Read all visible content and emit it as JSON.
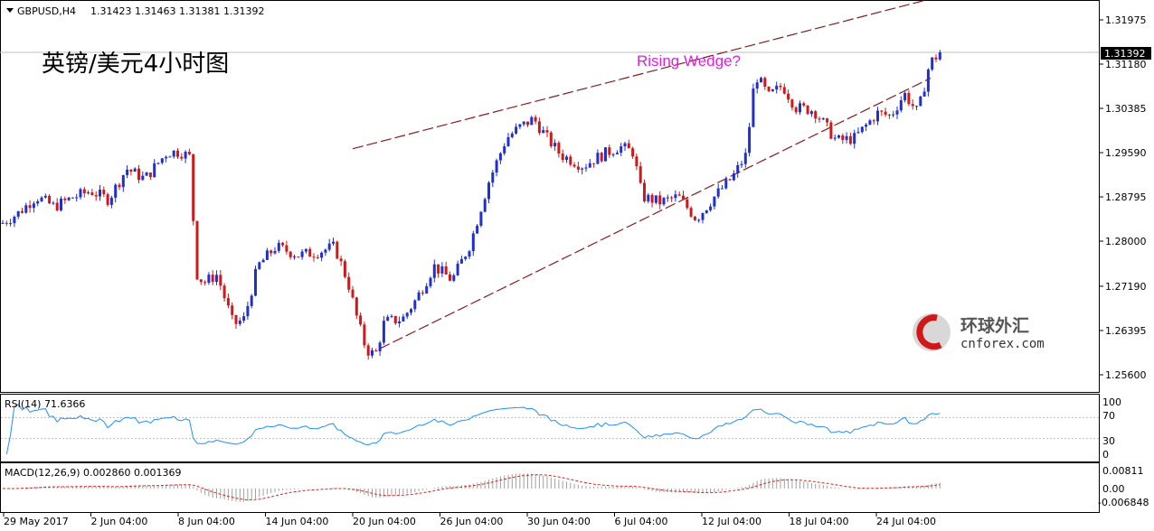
{
  "header": {
    "symbol": "GBPUSD,H4",
    "ohlc": "1.31423 1.31463 1.31381 1.31392",
    "chart_title": "英镑/美元4小时图",
    "annotation": "Rising Wedge?",
    "current_price_label": "1.31392"
  },
  "watermark": {
    "line1": "环球外汇",
    "line2": "cnforex.com"
  },
  "rsi": {
    "label": "RSI(14) 71.6366",
    "ticks": [
      "100",
      "70",
      "30",
      "0"
    ],
    "value": 71.6366
  },
  "macd": {
    "label": "MACD(12,26,9) 0.002860 0.001369",
    "ticks": [
      "0.00811",
      "0.00",
      "-0.006848"
    ]
  },
  "colors": {
    "bull": "#1f2fd0",
    "bear": "#d01818",
    "wedge": "#8b1a1a",
    "rsi_line": "#1e90ff",
    "macd_signal": "#e02020",
    "annotation": "#e020e0"
  },
  "chart_data": {
    "type": "candlestick",
    "title": "英镑/美元4小时图",
    "symbol": "GBPUSD,H4",
    "timeframe": "H4",
    "y_ticks": [
      "1.31975",
      "1.31180",
      "1.30385",
      "1.29590",
      "1.28795",
      "1.28000",
      "1.27190",
      "1.26395",
      "1.25600"
    ],
    "ylim": [
      1.2535,
      1.3222
    ],
    "x_ticks": [
      "29 May 2017",
      "2 Jun 04:00",
      "8 Jun 04:00",
      "14 Jun 04:00",
      "20 Jun 04:00",
      "26 Jun 04:00",
      "30 Jun 04:00",
      "6 Jul 04:00",
      "12 Jul 04:00",
      "18 Jul 04:00",
      "24 Jul 04:00"
    ],
    "last_close": 1.31392,
    "wedge_upper": {
      "from": [
        "20 Jun 04:00",
        1.2966
      ],
      "to": [
        "24 Jul 04:00",
        1.321
      ]
    },
    "wedge_lower": {
      "from": [
        "20 Jun 04:00",
        1.2583
      ],
      "to": [
        "24 Jul 04:00",
        1.3045
      ]
    },
    "price_path": [
      [
        0,
        1.283
      ],
      [
        20,
        1.285
      ],
      [
        40,
        1.288
      ],
      [
        60,
        1.2862
      ],
      [
        80,
        1.2878
      ],
      [
        100,
        1.289
      ],
      [
        120,
        1.2875
      ],
      [
        140,
        1.293
      ],
      [
        160,
        1.2912
      ],
      [
        185,
        1.296
      ],
      [
        200,
        1.296
      ],
      [
        211,
        1.295
      ],
      [
        216,
        1.2745
      ],
      [
        225,
        1.2725
      ],
      [
        240,
        1.274
      ],
      [
        258,
        1.265
      ],
      [
        270,
        1.266
      ],
      [
        285,
        1.2755
      ],
      [
        305,
        1.279
      ],
      [
        330,
        1.2775
      ],
      [
        350,
        1.278
      ],
      [
        370,
        1.279
      ],
      [
        385,
        1.2725
      ],
      [
        395,
        1.266
      ],
      [
        405,
        1.2605
      ],
      [
        415,
        1.2595
      ],
      [
        425,
        1.2655
      ],
      [
        445,
        1.266
      ],
      [
        460,
        1.2695
      ],
      [
        480,
        1.2755
      ],
      [
        500,
        1.273
      ],
      [
        520,
        1.2795
      ],
      [
        540,
        1.2905
      ],
      [
        560,
        1.2985
      ],
      [
        575,
        1.3005
      ],
      [
        590,
        1.302
      ],
      [
        605,
        1.2985
      ],
      [
        620,
        1.2955
      ],
      [
        645,
        1.2935
      ],
      [
        660,
        1.295
      ],
      [
        685,
        1.297
      ],
      [
        700,
        1.296
      ],
      [
        710,
        1.288
      ],
      [
        730,
        1.287
      ],
      [
        750,
        1.288
      ],
      [
        770,
        1.284
      ],
      [
        790,
        1.288
      ],
      [
        810,
        1.2915
      ],
      [
        825,
        1.2955
      ],
      [
        835,
        1.31
      ],
      [
        850,
        1.306
      ],
      [
        865,
        1.308
      ],
      [
        880,
        1.304
      ],
      [
        900,
        1.3035
      ],
      [
        925,
        1.298
      ],
      [
        945,
        1.2985
      ],
      [
        970,
        1.303
      ],
      [
        985,
        1.3025
      ],
      [
        1000,
        1.3065
      ],
      [
        1015,
        1.303
      ],
      [
        1028,
        1.312
      ],
      [
        1040,
        1.3139
      ]
    ]
  }
}
